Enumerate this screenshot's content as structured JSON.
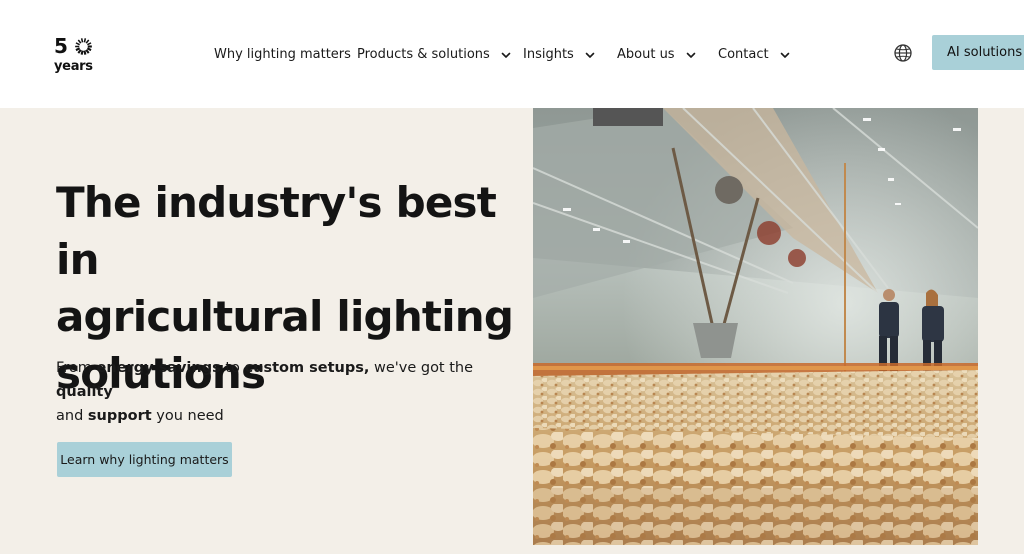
{
  "logo": {
    "number": "50",
    "word": "years"
  },
  "nav": {
    "items": [
      {
        "label": "Why lighting matters",
        "dropdown": false
      },
      {
        "label": "Products & solutions",
        "dropdown": true
      },
      {
        "label": "Insights",
        "dropdown": true
      },
      {
        "label": "About us",
        "dropdown": true
      },
      {
        "label": "Contact",
        "dropdown": true
      }
    ]
  },
  "header": {
    "language_icon": "globe-icon",
    "ai_button_label": "AI solutions"
  },
  "hero": {
    "title_lines": [
      "The industry's best in",
      "agricultural lighting",
      "solutions"
    ],
    "subtitle": {
      "p1": "From ",
      "b1": "energy savings",
      "p2": " to ",
      "b2": "custom setups,",
      "p3": " we've got the ",
      "b3": "quality",
      "p4": " and ",
      "b4": "support",
      "p5": " you need"
    },
    "cta_label": "Learn why lighting matters",
    "image": "poultry-house-photo"
  },
  "colors": {
    "accent": "#a9d0d8",
    "hero_bg": "#f3efe8",
    "text": "#1a1a1a"
  }
}
